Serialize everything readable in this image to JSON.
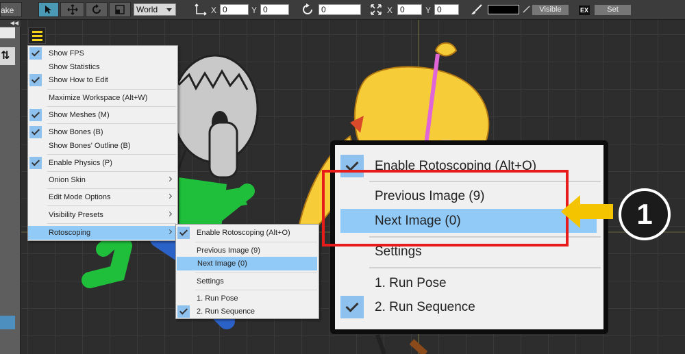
{
  "toolbar": {
    "left_clip_label": "ake",
    "space_select": "World",
    "position": {
      "x_label": "X",
      "x_value": "0",
      "y_label": "Y",
      "y_value": "0"
    },
    "rotation": {
      "value": "0"
    },
    "scale": {
      "x_label": "X",
      "x_value": "0",
      "y_label": "Y",
      "y_value": "0"
    },
    "visible_button": "Visible",
    "ex_label": "EX",
    "set_button": "Set",
    "colors": {
      "active_tool": "#4a9ab6",
      "color_swatch": "#000000"
    }
  },
  "left_panel": {
    "collapse_glyph": "◀◀",
    "sort_glyph": "⇅"
  },
  "view_menu": {
    "items": [
      {
        "label": "Show FPS",
        "checked": true
      },
      {
        "label": "Show Statistics",
        "checked": false
      },
      {
        "label": "Show How to Edit",
        "checked": true
      },
      {
        "label": "Maximize Workspace (Alt+W)",
        "checked": false
      },
      {
        "label": "Show Meshes (M)",
        "checked": true
      },
      {
        "label": "Show Bones (B)",
        "checked": true
      },
      {
        "label": "Show Bones' Outline (B)",
        "checked": false
      },
      {
        "label": "Enable Physics (P)",
        "checked": true
      },
      {
        "label": "Onion Skin",
        "submenu": true
      },
      {
        "label": "Edit Mode Options",
        "submenu": true
      },
      {
        "label": "Visibility Presets",
        "submenu": true
      },
      {
        "label": "Rotoscoping",
        "submenu": true,
        "highlighted": true
      }
    ]
  },
  "rotoscoping_menu": {
    "items": [
      {
        "label": "Enable Rotoscoping (Alt+O)",
        "checked": true
      },
      {
        "label": "Previous Image (9)"
      },
      {
        "label": "Next Image (0)",
        "highlighted": true
      },
      {
        "label": "Settings"
      },
      {
        "label": "1. Run Pose"
      },
      {
        "label": "2. Run Sequence",
        "checked": true
      }
    ]
  },
  "callout": {
    "items": [
      "Enable Rotoscoping (Alt+O)",
      "Previous Image (9)",
      "Next Image (0)",
      "Settings",
      "1. Run Pose",
      "2. Run Sequence"
    ],
    "step_number": "1",
    "colors": {
      "highlight_box": "#e81b1b",
      "arrow": "#f5c400",
      "menu_highlight": "#91c9f7"
    }
  }
}
